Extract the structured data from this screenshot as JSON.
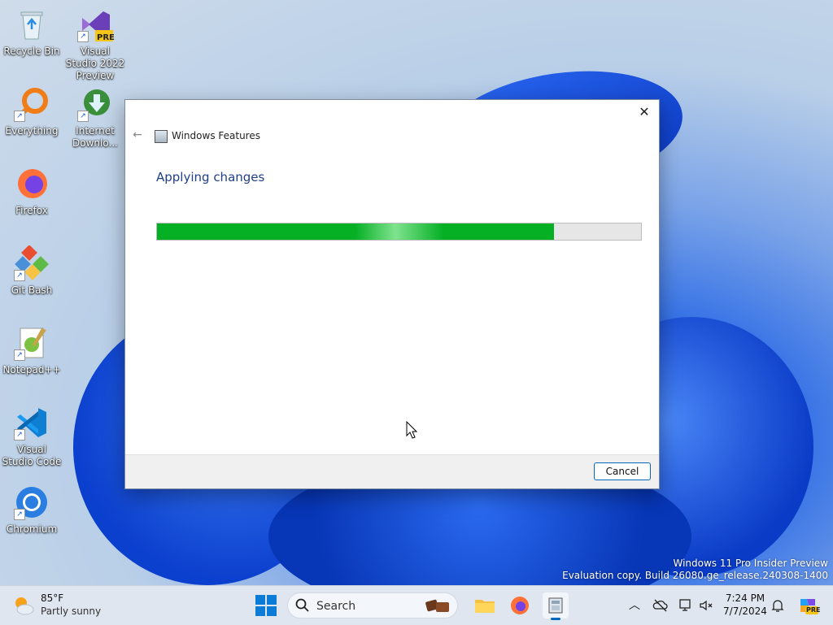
{
  "desktop": {
    "icons": [
      {
        "label": "Recycle Bin",
        "icon": "recycle-bin-icon"
      },
      {
        "label": "Visual Studio 2022 Preview",
        "icon": "visual-studio-icon",
        "badge": "PRE"
      },
      {
        "label": "Everything",
        "icon": "everything-search-icon"
      },
      {
        "label": "Internet Downlo...",
        "icon": "internet-download-manager-icon"
      },
      {
        "label": "Firefox",
        "icon": "firefox-icon"
      },
      {
        "label": "Git Bash",
        "icon": "git-bash-icon"
      },
      {
        "label": "Notepad++",
        "icon": "notepad-plus-plus-icon"
      },
      {
        "label": "Visual Studio Code",
        "icon": "vscode-icon"
      },
      {
        "label": "Chromium",
        "icon": "chromium-icon"
      }
    ]
  },
  "dialog": {
    "title": "Windows Features",
    "heading": "Applying changes",
    "progress_fraction": 0.82,
    "cancel_label": "Cancel",
    "close_glyph": "✕",
    "back_glyph": "←",
    "accent": "#06b025"
  },
  "watermark": {
    "line1": "Windows 11 Pro Insider Preview",
    "line2": "Evaluation copy. Build 26080.ge_release.240308-1400"
  },
  "taskbar": {
    "weather": {
      "temp": "85°F",
      "desc": "Partly sunny"
    },
    "search_placeholder": "Search",
    "apps": [
      "start-icon",
      "file-explorer-icon",
      "firefox-icon",
      "windows-features-icon"
    ],
    "clock": {
      "time": "7:24 PM",
      "date": "7/7/2024"
    },
    "copilot_badge": "PRE"
  }
}
